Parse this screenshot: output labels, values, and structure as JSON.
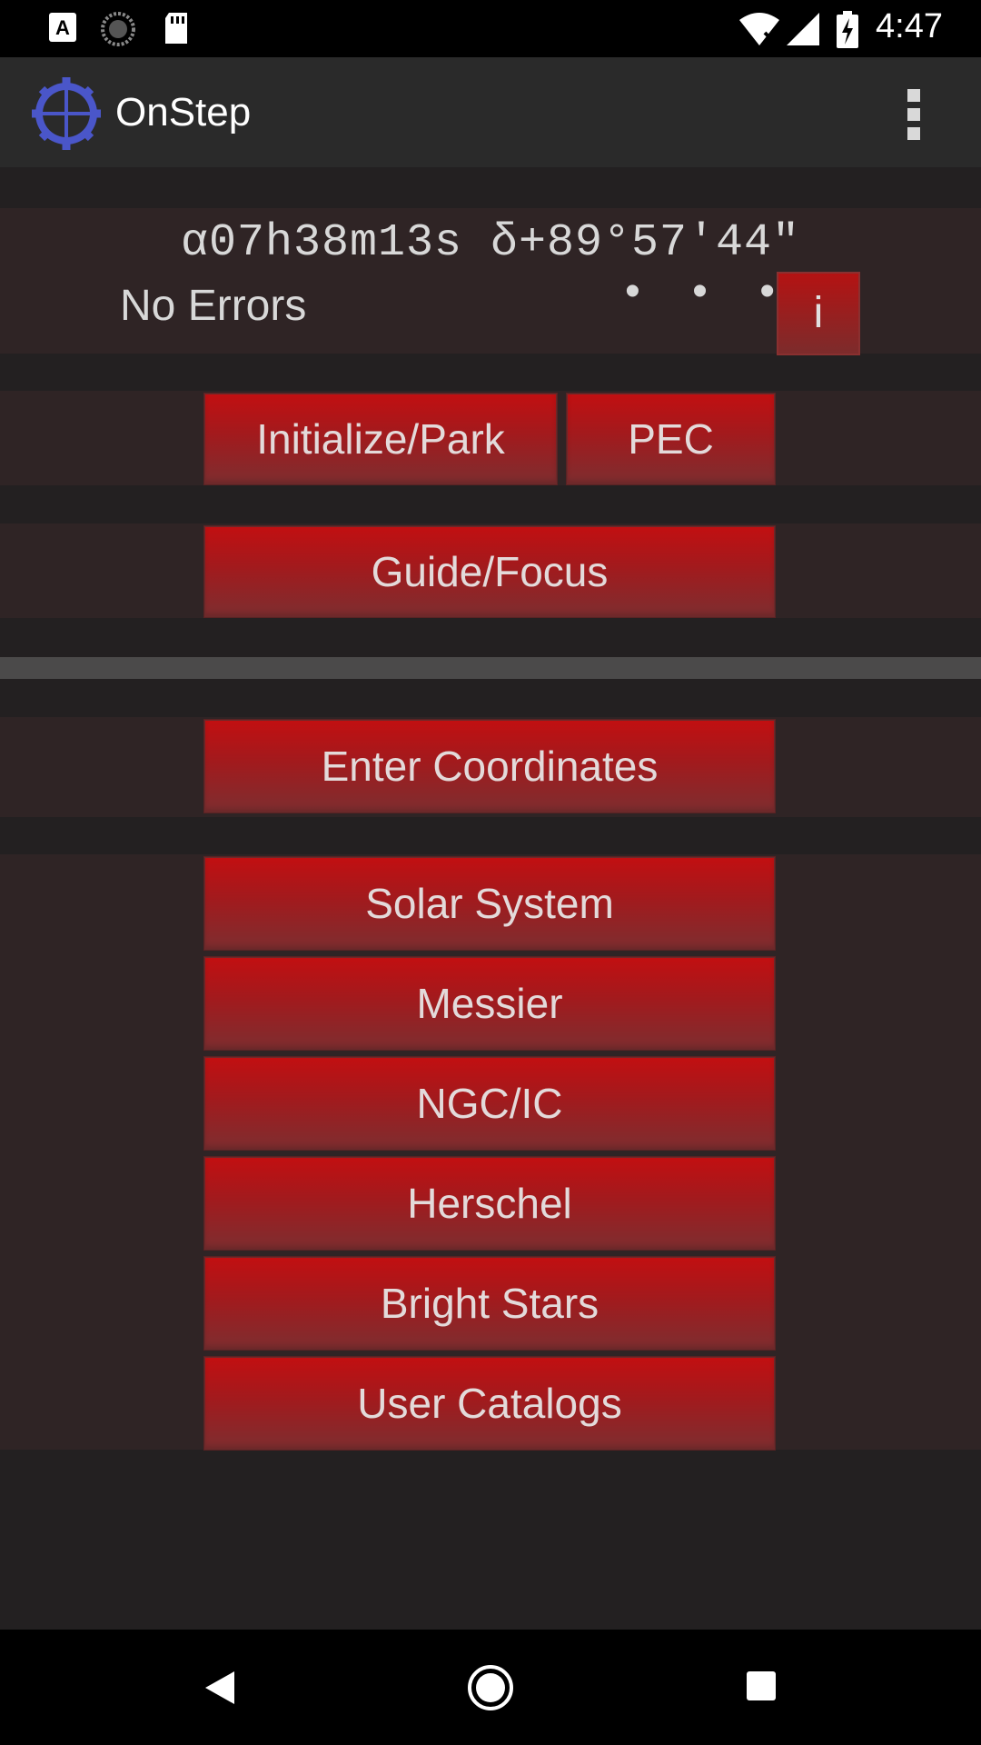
{
  "status_bar": {
    "time": "4:47",
    "icons": [
      "text-a-icon",
      "sync-icon",
      "sd-card-icon",
      "wifi-icon",
      "signal-icon",
      "battery-icon"
    ]
  },
  "app_bar": {
    "title": "OnStep",
    "logo_icon": "crosshair-gear-icon",
    "menu_icon": "overflow-menu-icon"
  },
  "status_panel": {
    "coordinates": "α07h38m13s δ+89°57'44\"",
    "errors": "No Errors",
    "dots": "• • •",
    "info_label": "i"
  },
  "buttons": {
    "initialize_park": "Initialize/Park",
    "pec": "PEC",
    "guide_focus": "Guide/Focus",
    "enter_coordinates": "Enter Coordinates"
  },
  "catalogs": [
    {
      "label": "Solar System"
    },
    {
      "label": "Messier"
    },
    {
      "label": "NGC/IC"
    },
    {
      "label": "Herschel"
    },
    {
      "label": "Bright Stars"
    },
    {
      "label": "User Catalogs"
    }
  ],
  "nav_bar": {
    "icons": [
      "back-icon",
      "home-icon",
      "recents-icon"
    ]
  },
  "colors": {
    "accent_red": "#c20f11",
    "panel_bg": "#2f2425",
    "page_bg": "#232021"
  }
}
